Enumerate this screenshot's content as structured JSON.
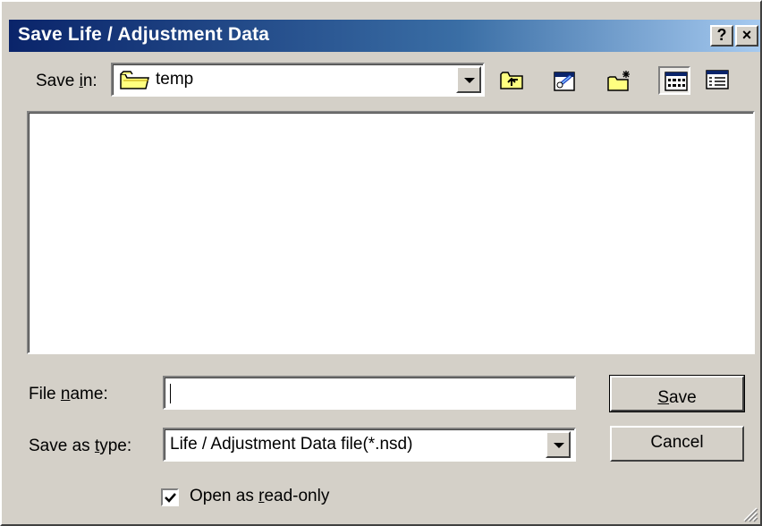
{
  "dialog": {
    "title": "Save Life / Adjustment Data",
    "help_glyph": "?",
    "close_glyph": "×"
  },
  "toolbar": {
    "save_in_label_prefix": "Save ",
    "save_in_label_accel": "i",
    "save_in_label_suffix": "n:",
    "save_in_value": "temp",
    "icons": [
      "up-one-level-icon",
      "create-shortcut-icon",
      "new-folder-icon",
      "list-view-icon",
      "details-view-icon"
    ]
  },
  "form": {
    "file_name_label_prefix": "File ",
    "file_name_label_accel": "n",
    "file_name_label_suffix": "ame:",
    "file_name_value": "",
    "save_as_type_label_prefix": "Save as ",
    "save_as_type_label_accel": "t",
    "save_as_type_label_suffix": "ype:",
    "save_as_type_value": "Life / Adjustment Data file(*.nsd)",
    "read_only_prefix": "Open as ",
    "read_only_accel": "r",
    "read_only_suffix": "ead-only",
    "read_only_checked": true
  },
  "buttons": {
    "save_accel": "S",
    "save_rest": "ave",
    "cancel_label": "Cancel"
  },
  "colors": {
    "titlebar_start": "#0a246a",
    "titlebar_end": "#a6caf0",
    "face": "#d4d0c8"
  }
}
